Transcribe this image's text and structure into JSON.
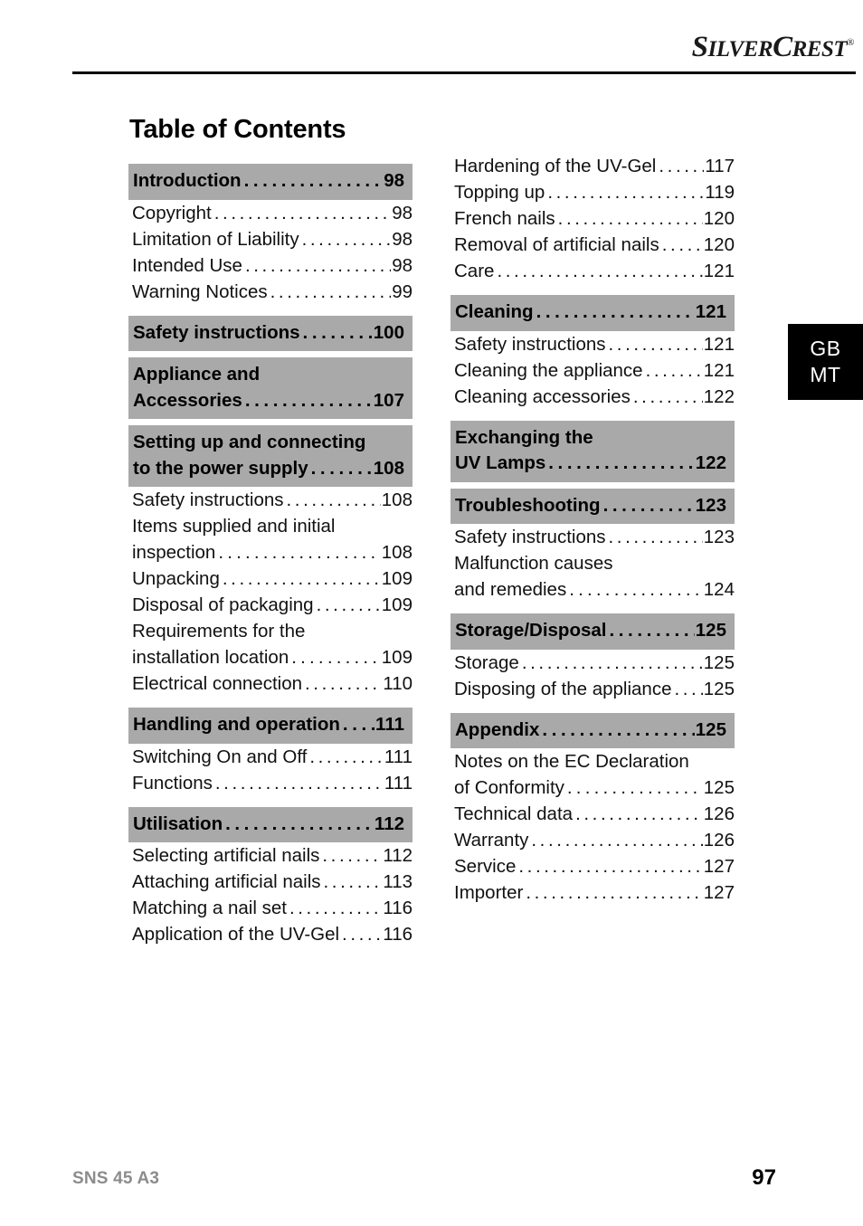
{
  "brand": {
    "name_part1": "S",
    "name_part2": "ILVER",
    "name_part3": "C",
    "name_part4": "REST",
    "trademark": "®"
  },
  "page_title": "Table of Contents",
  "language_tab": {
    "line1": "GB",
    "line2": "MT"
  },
  "footer": {
    "model": "SNS 45 A3",
    "page_number": "97"
  },
  "colors": {
    "section_bar": "#a9a9a9",
    "tab_background": "#000000",
    "tab_text": "#ffffff",
    "footer_model": "#8c8c8c",
    "text": "#000000"
  },
  "leader": "...............................",
  "columns": {
    "left": [
      {
        "kind": "section",
        "lines": [
          "Introduction"
        ],
        "page": "98"
      },
      {
        "kind": "sub",
        "lines": [
          "Copyright"
        ],
        "page": "98"
      },
      {
        "kind": "sub",
        "lines": [
          "Limitation of Liability"
        ],
        "page": "98"
      },
      {
        "kind": "sub",
        "lines": [
          "Intended Use"
        ],
        "page": "98"
      },
      {
        "kind": "sub",
        "lines": [
          "Warning Notices"
        ],
        "page": "99"
      },
      {
        "kind": "section",
        "lines": [
          "Safety instructions"
        ],
        "page": "100"
      },
      {
        "kind": "section",
        "lines": [
          "Appliance and",
          "Accessories"
        ],
        "page": "107"
      },
      {
        "kind": "section",
        "lines": [
          "Setting up and connecting",
          "to the power supply"
        ],
        "page": "108"
      },
      {
        "kind": "sub",
        "lines": [
          "Safety instructions"
        ],
        "page": "108"
      },
      {
        "kind": "sub",
        "lines": [
          "Items supplied and initial",
          "inspection"
        ],
        "page": "108"
      },
      {
        "kind": "sub",
        "lines": [
          "Unpacking"
        ],
        "page": "109"
      },
      {
        "kind": "sub",
        "lines": [
          "Disposal of packaging"
        ],
        "page": "109"
      },
      {
        "kind": "sub",
        "lines": [
          "Requirements for the",
          "installation location"
        ],
        "page": "109"
      },
      {
        "kind": "sub",
        "lines": [
          "Electrical connection"
        ],
        "page": "110"
      },
      {
        "kind": "section",
        "lines": [
          "Handling and operation"
        ],
        "page": "111"
      },
      {
        "kind": "sub",
        "lines": [
          "Switching On and Off"
        ],
        "page": "111"
      },
      {
        "kind": "sub",
        "lines": [
          "Functions"
        ],
        "page": "111"
      },
      {
        "kind": "section",
        "lines": [
          "Utilisation"
        ],
        "page": "112"
      },
      {
        "kind": "sub",
        "lines": [
          "Selecting artificial nails"
        ],
        "page": "112"
      },
      {
        "kind": "sub",
        "lines": [
          "Attaching artificial nails"
        ],
        "page": "113"
      },
      {
        "kind": "sub",
        "lines": [
          "Matching a nail set"
        ],
        "page": "116"
      },
      {
        "kind": "sub",
        "lines": [
          "Application of the UV-Gel"
        ],
        "page": "116"
      }
    ],
    "right": [
      {
        "kind": "sub",
        "lines": [
          "Hardening of the UV-Gel"
        ],
        "page": "117"
      },
      {
        "kind": "sub",
        "lines": [
          "Topping up"
        ],
        "page": "119"
      },
      {
        "kind": "sub",
        "lines": [
          "French nails"
        ],
        "page": "120"
      },
      {
        "kind": "sub",
        "lines": [
          "Removal of artificial nails"
        ],
        "page": "120"
      },
      {
        "kind": "sub",
        "lines": [
          "Care"
        ],
        "page": "121"
      },
      {
        "kind": "section",
        "lines": [
          "Cleaning"
        ],
        "page": "121"
      },
      {
        "kind": "sub",
        "lines": [
          "Safety instructions"
        ],
        "page": "121"
      },
      {
        "kind": "sub",
        "lines": [
          "Cleaning the appliance"
        ],
        "page": "121"
      },
      {
        "kind": "sub",
        "lines": [
          "Cleaning accessories"
        ],
        "page": "122"
      },
      {
        "kind": "section",
        "lines": [
          "Exchanging the",
          "UV Lamps"
        ],
        "page": "122"
      },
      {
        "kind": "section",
        "lines": [
          "Troubleshooting"
        ],
        "page": "123"
      },
      {
        "kind": "sub",
        "lines": [
          "Safety instructions"
        ],
        "page": "123"
      },
      {
        "kind": "sub",
        "lines": [
          "Malfunction causes",
          "and remedies"
        ],
        "page": "124"
      },
      {
        "kind": "section",
        "lines": [
          "Storage/Disposal"
        ],
        "page": "125"
      },
      {
        "kind": "sub",
        "lines": [
          "Storage"
        ],
        "page": "125"
      },
      {
        "kind": "sub",
        "lines": [
          "Disposing of the appliance"
        ],
        "page": "125"
      },
      {
        "kind": "section",
        "lines": [
          "Appendix"
        ],
        "page": "125"
      },
      {
        "kind": "sub",
        "lines": [
          "Notes on the EC Declaration",
          "of Conformity"
        ],
        "page": "125"
      },
      {
        "kind": "sub",
        "lines": [
          "Technical data"
        ],
        "page": "126"
      },
      {
        "kind": "sub",
        "lines": [
          "Warranty"
        ],
        "page": "126"
      },
      {
        "kind": "sub",
        "lines": [
          "Service"
        ],
        "page": "127"
      },
      {
        "kind": "sub",
        "lines": [
          "Importer"
        ],
        "page": "127"
      }
    ]
  }
}
